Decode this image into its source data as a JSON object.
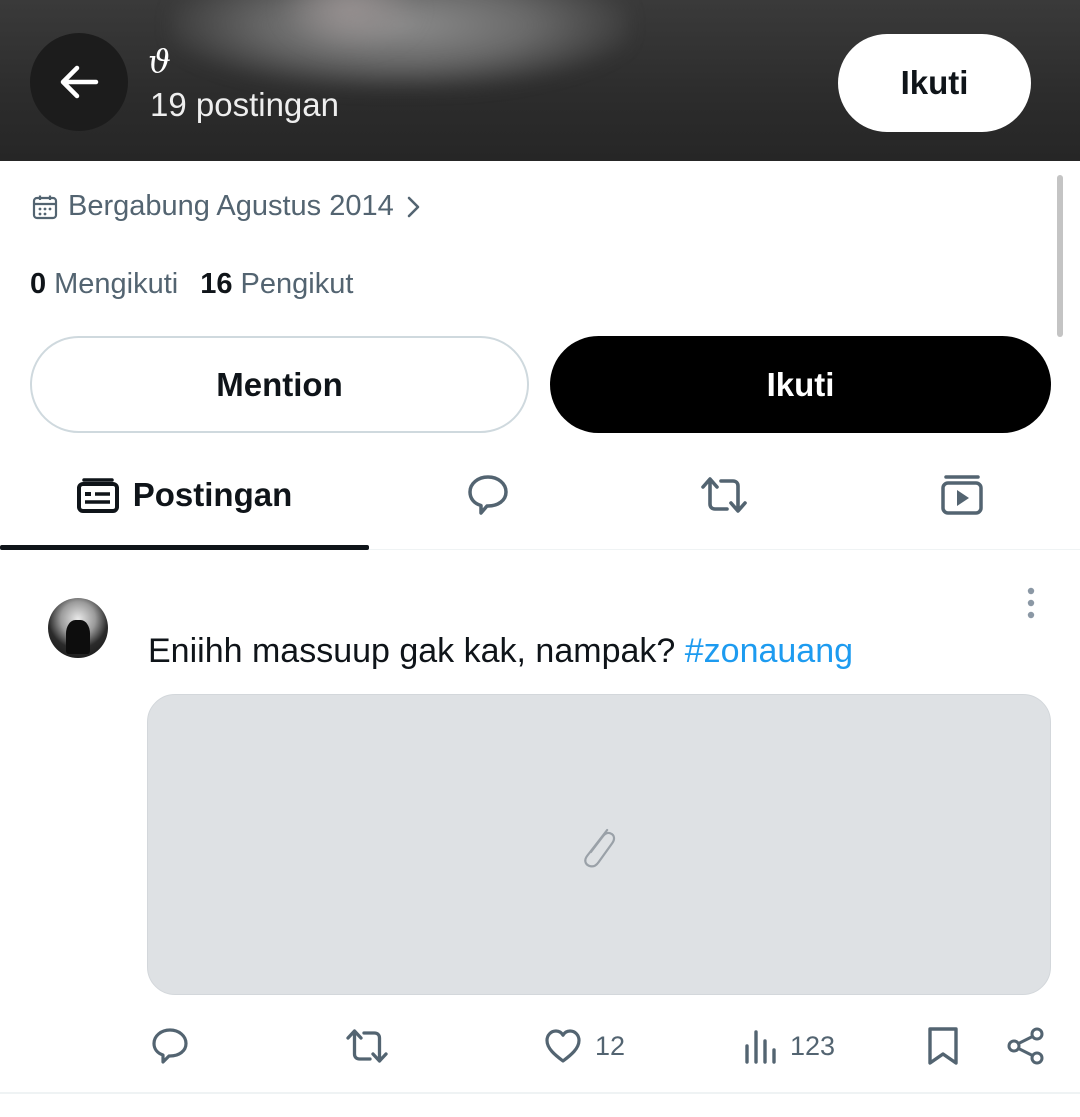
{
  "header": {
    "name": "ϑ",
    "post_count": "19 postingan",
    "follow_label": "Ikuti",
    "back_icon": "arrow-left-icon"
  },
  "profile": {
    "joined": "Bergabung Agustus 2014",
    "following_count": "0",
    "following_label": "Mengikuti",
    "followers_count": "16",
    "followers_label": "Pengikut"
  },
  "buttons": {
    "mention": "Mention",
    "follow": "Ikuti"
  },
  "tabs": {
    "posts_label": "Postingan",
    "icons": [
      "posts-icon",
      "replies-icon",
      "reposts-icon",
      "media-icon"
    ],
    "active": "posts"
  },
  "post": {
    "text": "Eniihh massuup gak kak, nampak? ",
    "hashtag": "#zonauang",
    "media_icon": "paperclip-icon",
    "likes": "12",
    "views": "123"
  },
  "colors": {
    "accent": "#1d9bf0",
    "text_primary": "#0f1419",
    "text_secondary": "#536471",
    "border": "#cfd9de",
    "media_placeholder": "#dee1e4"
  }
}
